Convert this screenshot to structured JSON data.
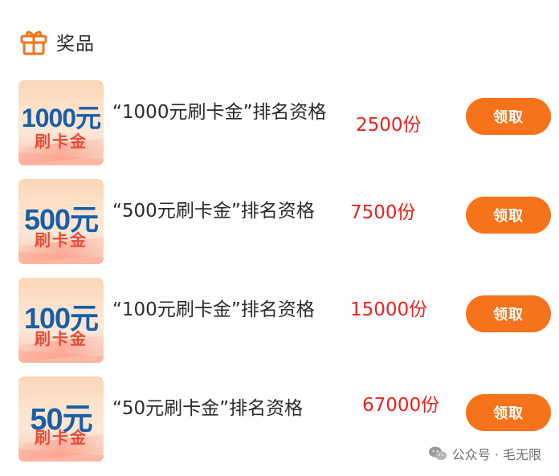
{
  "section": {
    "title": "奖品",
    "icon": "gift-icon"
  },
  "prizes": [
    {
      "amount": "1000元",
      "sub": "刷卡金",
      "name": "“1000元刷卡金”排名资格",
      "qty": "2500份",
      "button": "领取"
    },
    {
      "amount": "500元",
      "sub": "刷卡金",
      "name": "“500元刷卡金”排名资格",
      "qty": "7500份",
      "button": "领取"
    },
    {
      "amount": "100元",
      "sub": "刷卡金",
      "name": "“100元刷卡金”排名资格",
      "qty": "15000份",
      "button": "领取"
    },
    {
      "amount": "50元",
      "sub": "刷卡金",
      "name": "“50元刷卡金”排名资格",
      "qty": "67000份",
      "button": "领取"
    }
  ],
  "watermark": {
    "text": "公众号 · 毛无限",
    "icon": "wechat-icon"
  },
  "colors": {
    "accent": "#f7731b",
    "qty_red": "#e8231f",
    "thumb_blue": "#1a5ea8",
    "thumb_red": "#e64a3a"
  }
}
